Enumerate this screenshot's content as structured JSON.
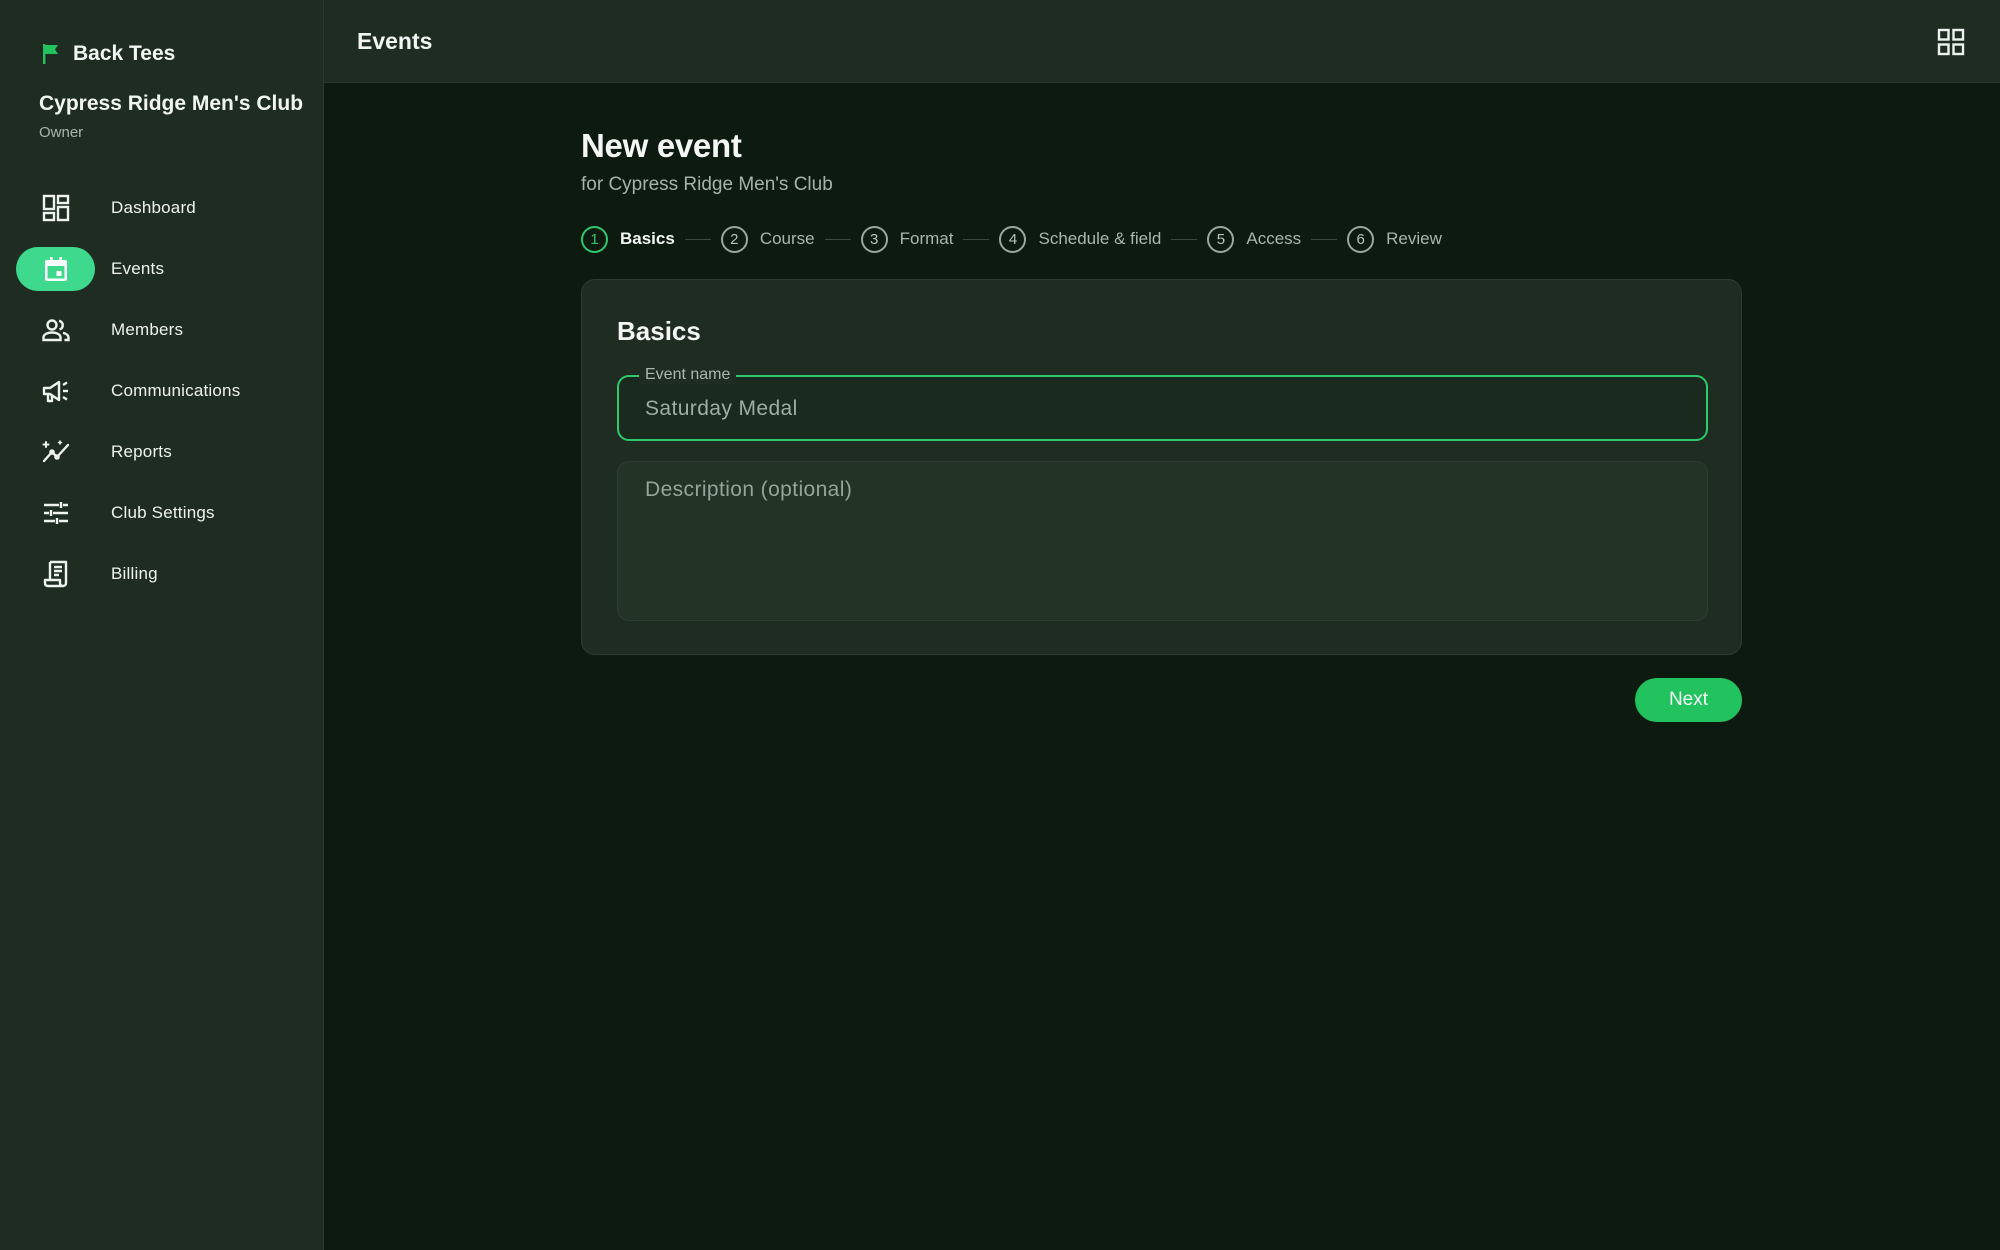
{
  "sidebar": {
    "brand": "Back Tees",
    "club_name": "Cypress Ridge Men's Club",
    "role": "Owner",
    "items": [
      {
        "label": "Dashboard",
        "icon": "dashboard-icon",
        "active": false
      },
      {
        "label": "Events",
        "icon": "calendar-icon",
        "active": true
      },
      {
        "label": "Members",
        "icon": "people-icon",
        "active": false
      },
      {
        "label": "Communications",
        "icon": "megaphone-icon",
        "active": false
      },
      {
        "label": "Reports",
        "icon": "trend-icon",
        "active": false
      },
      {
        "label": "Club Settings",
        "icon": "sliders-icon",
        "active": false
      },
      {
        "label": "Billing",
        "icon": "receipt-icon",
        "active": false
      }
    ]
  },
  "topbar": {
    "title": "Events",
    "apps_icon": "apps-grid-icon"
  },
  "main": {
    "title": "New event",
    "subtitle": "for Cypress Ridge Men's Club",
    "steps": [
      {
        "number": "1",
        "label": "Basics",
        "active": true
      },
      {
        "number": "2",
        "label": "Course",
        "active": false
      },
      {
        "number": "3",
        "label": "Format",
        "active": false
      },
      {
        "number": "4",
        "label": "Schedule & field",
        "active": false
      },
      {
        "number": "5",
        "label": "Access",
        "active": false
      },
      {
        "number": "6",
        "label": "Review",
        "active": false
      }
    ],
    "card": {
      "title": "Basics",
      "event_name_label": "Event name",
      "event_name_value": "Saturday Medal",
      "description_placeholder": "Description (optional)"
    },
    "next_label": "Next"
  },
  "colors": {
    "accent": "#22c35e",
    "active_nav": "#3fd98e",
    "background": "#0d1a10",
    "surface": "#1f2c22"
  }
}
